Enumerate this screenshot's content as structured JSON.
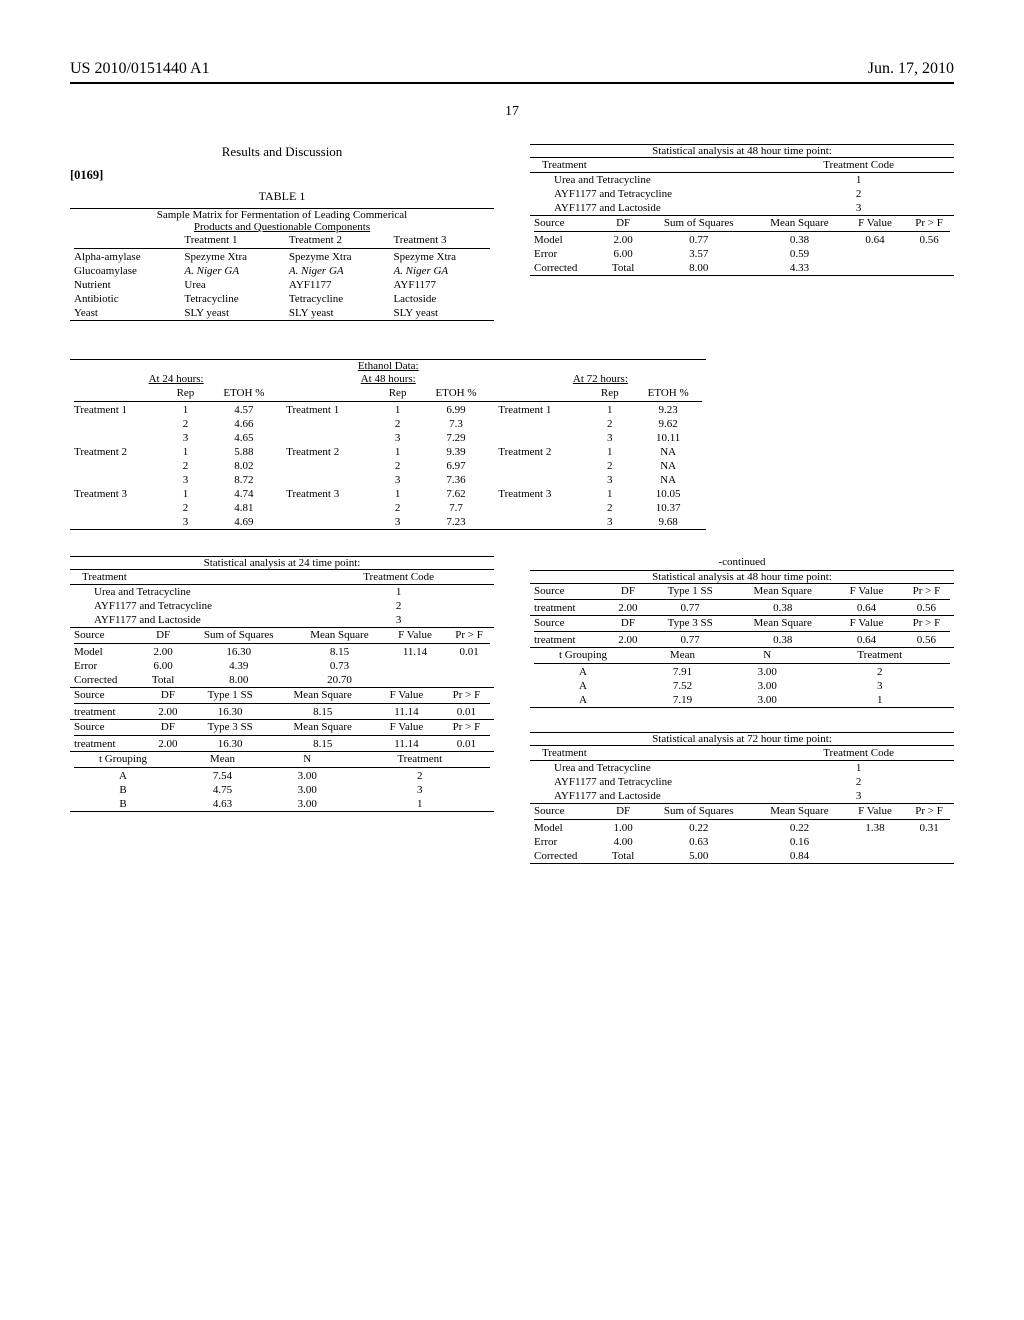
{
  "header": {
    "left": "US 2010/0151440 A1",
    "right": "Jun. 17, 2010"
  },
  "pagenum": "17",
  "section": {
    "title": "Results and Discussion"
  },
  "para": {
    "num": "[0169]"
  },
  "table1": {
    "title": "TABLE 1",
    "caption1": "Sample Matrix for Fermentation of Leading Commerical",
    "caption2": "Products and Questionable Components",
    "cols": [
      "",
      "Treatment 1",
      "Treatment 2",
      "Treatment 3"
    ],
    "rows": [
      [
        "Alpha-amylase",
        "Spezyme Xtra",
        "Spezyme Xtra",
        "Spezyme Xtra"
      ],
      [
        "Glucoamylase",
        "A. Niger GA",
        "A. Niger GA",
        "A. Niger GA"
      ],
      [
        "Nutrient",
        "Urea",
        "AYF1177",
        "AYF1177"
      ],
      [
        "Antibiotic",
        "Tetracycline",
        "Tetracycline",
        "Lactoside"
      ],
      [
        "Yeast",
        "SLY yeast",
        "SLY yeast",
        "SLY yeast"
      ]
    ],
    "italicRow": 1
  },
  "ethanol": {
    "title": "Ethanol Data:",
    "groups": [
      "At 24 hours:",
      "At 48 hours:",
      "At 72 hours:"
    ],
    "sub": [
      "",
      "Rep",
      "ETOH %"
    ],
    "rows": [
      [
        "Treatment 1",
        "1",
        "4.57",
        "Treatment 1",
        "1",
        "6.99",
        "Treatment 1",
        "1",
        "9.23"
      ],
      [
        "",
        "2",
        "4.66",
        "",
        "2",
        "7.3",
        "",
        "2",
        "9.62"
      ],
      [
        "",
        "3",
        "4.65",
        "",
        "3",
        "7.29",
        "",
        "3",
        "10.11"
      ],
      [
        "Treatment 2",
        "1",
        "5.88",
        "Treatment 2",
        "1",
        "9.39",
        "Treatment 2",
        "1",
        "NA"
      ],
      [
        "",
        "2",
        "8.02",
        "",
        "2",
        "6.97",
        "",
        "2",
        "NA"
      ],
      [
        "",
        "3",
        "8.72",
        "",
        "3",
        "7.36",
        "",
        "3",
        "NA"
      ],
      [
        "Treatment 3",
        "1",
        "4.74",
        "Treatment 3",
        "1",
        "7.62",
        "Treatment 3",
        "1",
        "10.05"
      ],
      [
        "",
        "2",
        "4.81",
        "",
        "2",
        "7.7",
        "",
        "2",
        "10.37"
      ],
      [
        "",
        "3",
        "4.69",
        "",
        "3",
        "7.23",
        "",
        "3",
        "9.68"
      ]
    ]
  },
  "stats24": {
    "caption": "Statistical analysis at 24 time point:",
    "treatHead": [
      "Treatment",
      "Treatment Code"
    ],
    "treatRows": [
      [
        "Urea and Tetracycline",
        "1"
      ],
      [
        "AYF1177 and Tetracycline",
        "2"
      ],
      [
        "AYF1177 and Lactoside",
        "3"
      ]
    ],
    "anovaHead": [
      "Source",
      "DF",
      "Sum of Squares",
      "Mean Square",
      "F Value",
      "Pr > F"
    ],
    "anovaRows": [
      [
        "Model",
        "2.00",
        "16.30",
        "8.15",
        "11.14",
        "0.01"
      ],
      [
        "Error",
        "6.00",
        "4.39",
        "0.73",
        "",
        ""
      ],
      [
        "Corrected",
        "Total",
        "8.00",
        "20.70",
        "",
        ""
      ]
    ],
    "t1Head": [
      "Source",
      "DF",
      "Type 1 SS",
      "Mean Square",
      "F Value",
      "Pr > F"
    ],
    "t1Row": [
      "treatment",
      "2.00",
      "16.30",
      "8.15",
      "11.14",
      "0.01"
    ],
    "t3Head": [
      "Source",
      "DF",
      "Type 3 SS",
      "Mean Square",
      "F Value",
      "Pr > F"
    ],
    "t3Row": [
      "treatment",
      "2.00",
      "16.30",
      "8.15",
      "11.14",
      "0.01"
    ],
    "groupHead": [
      "t Grouping",
      "Mean",
      "N",
      "Treatment"
    ],
    "groupRows": [
      [
        "A",
        "7.54",
        "3.00",
        "2"
      ],
      [
        "B",
        "4.75",
        "3.00",
        "3"
      ],
      [
        "B",
        "4.63",
        "3.00",
        "1"
      ]
    ]
  },
  "stats48top": {
    "caption": "Statistical analysis at 48 hour time point:",
    "treatHead": [
      "Treatment",
      "Treatment Code"
    ],
    "treatRows": [
      [
        "Urea and Tetracycline",
        "1"
      ],
      [
        "AYF1177 and Tetracycline",
        "2"
      ],
      [
        "AYF1177 and Lactoside",
        "3"
      ]
    ],
    "anovaHead": [
      "Source",
      "DF",
      "Sum of Squares",
      "Mean Square",
      "F Value",
      "Pr > F"
    ],
    "anovaRows": [
      [
        "Model",
        "2.00",
        "0.77",
        "0.38",
        "0.64",
        "0.56"
      ],
      [
        "Error",
        "6.00",
        "3.57",
        "0.59",
        "",
        ""
      ],
      [
        "Corrected",
        "Total",
        "8.00",
        "4.33",
        "",
        ""
      ]
    ]
  },
  "stats48cont": {
    "contlabel": "-continued",
    "caption": "Statistical analysis at 48 hour time point:",
    "t1Head": [
      "Source",
      "DF",
      "Type 1 SS",
      "Mean Square",
      "F Value",
      "Pr > F"
    ],
    "t1Row": [
      "treatment",
      "2.00",
      "0.77",
      "0.38",
      "0.64",
      "0.56"
    ],
    "t3Head": [
      "Source",
      "DF",
      "Type 3 SS",
      "Mean Square",
      "F Value",
      "Pr > F"
    ],
    "t3Row": [
      "treatment",
      "2.00",
      "0.77",
      "0.38",
      "0.64",
      "0.56"
    ],
    "groupHead": [
      "t Grouping",
      "Mean",
      "N",
      "Treatment"
    ],
    "groupRows": [
      [
        "A",
        "7.91",
        "3.00",
        "2"
      ],
      [
        "A",
        "7.52",
        "3.00",
        "3"
      ],
      [
        "A",
        "7.19",
        "3.00",
        "1"
      ]
    ]
  },
  "stats72": {
    "caption": "Statistical analysis at 72 hour time point:",
    "treatHead": [
      "Treatment",
      "Treatment Code"
    ],
    "treatRows": [
      [
        "Urea and Tetracycline",
        "1"
      ],
      [
        "AYF1177 and Tetracycline",
        "2"
      ],
      [
        "AYF1177 and Lactoside",
        "3"
      ]
    ],
    "anovaHead": [
      "Source",
      "DF",
      "Sum of Squares",
      "Mean Square",
      "F Value",
      "Pr > F"
    ],
    "anovaRows": [
      [
        "Model",
        "1.00",
        "0.22",
        "0.22",
        "1.38",
        "0.31"
      ],
      [
        "Error",
        "4.00",
        "0.63",
        "0.16",
        "",
        ""
      ],
      [
        "Corrected",
        "Total",
        "5.00",
        "0.84",
        "",
        ""
      ]
    ]
  }
}
